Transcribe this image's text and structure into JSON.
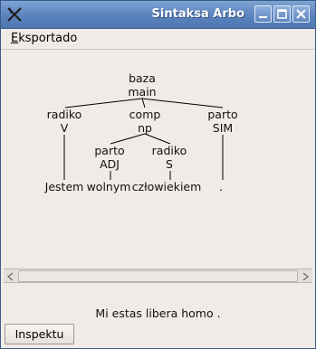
{
  "window": {
    "title": "Sintaksa Arbo",
    "controls": [
      "minimize",
      "maximize",
      "close"
    ],
    "icon": "app-x-icon"
  },
  "menu": {
    "items": [
      {
        "label_underlined": "E",
        "label_rest": "ksportado"
      }
    ]
  },
  "tree": {
    "root": {
      "label": "baza",
      "tag": "main"
    },
    "level1": [
      {
        "label": "radiko",
        "tag": "V"
      },
      {
        "label": "comp",
        "tag": "np"
      },
      {
        "label": "parto",
        "tag": "SIM"
      }
    ],
    "level2": [
      {
        "label": "parto",
        "tag": "ADJ"
      },
      {
        "label": "radiko",
        "tag": "S"
      }
    ],
    "words": [
      "Jestem",
      "wolnym",
      "człowiekiem",
      "."
    ]
  },
  "sentence": "Mi estas libera homo .",
  "button": {
    "label": "Inspektu"
  }
}
